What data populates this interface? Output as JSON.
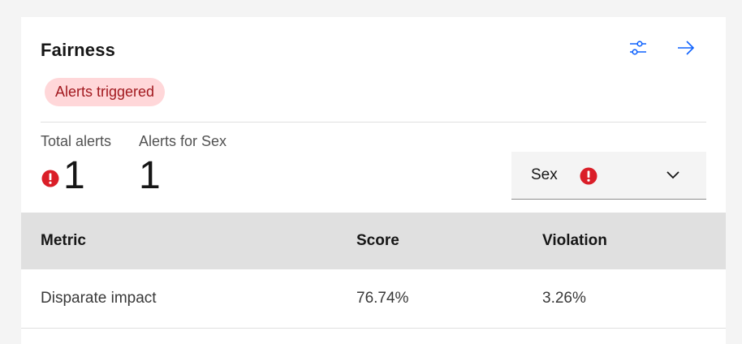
{
  "card": {
    "title": "Fairness",
    "actions": [
      {
        "icon": "settings-adjust-icon"
      },
      {
        "icon": "arrow-right-icon"
      }
    ],
    "tag": "Alerts triggered"
  },
  "stats": {
    "total_label": "Total alerts",
    "total_value": "1",
    "for_label": "Alerts for Sex",
    "for_value": "1"
  },
  "dropdown": {
    "selected": "Sex",
    "has_alert": true
  },
  "table": {
    "headers": [
      "Metric",
      "Score",
      "Violation"
    ],
    "rows": [
      [
        "Disparate impact",
        "76.74%",
        "3.26%"
      ]
    ]
  },
  "colors": {
    "accent": "#0f62fe",
    "error": "#da1e28",
    "tag_bg": "#ffd7d9",
    "tag_text": "#a2191f",
    "header_bg": "#e0e0e0",
    "page_bg": "#f4f4f4"
  }
}
